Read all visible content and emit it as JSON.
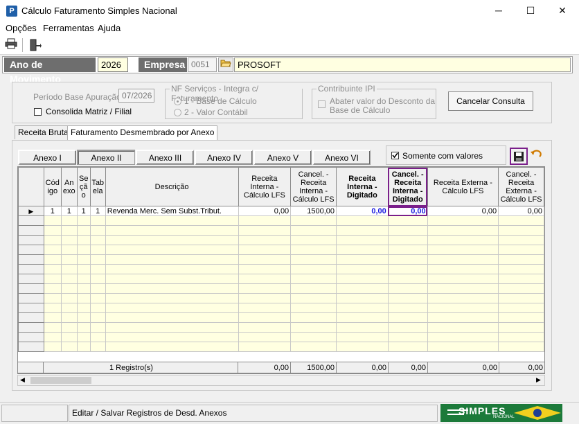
{
  "window": {
    "title": "Cálculo Faturamento Simples Nacional",
    "app_icon": "P",
    "minimize": "─",
    "maximize": "☐",
    "close": "✕"
  },
  "menu": {
    "items": [
      "Opções",
      "Ferramentas",
      "Ajuda"
    ]
  },
  "toolbar": {
    "print_icon": "printer-icon",
    "exit_icon": "exit-door-icon"
  },
  "header": {
    "ano_label": "Ano de Movimento",
    "ano_value": "2026",
    "empresa_label": "Empresa",
    "empresa_code": "0051",
    "empresa_name": "PROSOFT"
  },
  "filters": {
    "periodo_label": "Período Base Apuração:",
    "periodo_value": "07/2026",
    "consolida_label": "Consolida Matriz / Filial",
    "nf_group_title": "NF Serviços - Integra c/ Faturamento",
    "nf_option1": "1 - Base de Cálculo",
    "nf_option2": "2 - Valor Contábil",
    "ipi_group_title": "Contribuinte IPI",
    "ipi_check_line1": "Abater valor do Desconto da",
    "ipi_check_line2": "Base de Cálculo",
    "cancel_button": "Cancelar Consulta"
  },
  "tabs": [
    "Receita Bruta",
    "Faturamento Desmembrado por Anexo"
  ],
  "anexos": [
    "Anexo I",
    "Anexo II",
    "Anexo III",
    "Anexo IV",
    "Anexo V",
    "Anexo VI"
  ],
  "somente_label": "Somente com valores",
  "grid": {
    "headers": {
      "codigo": [
        "Cód",
        "igo"
      ],
      "anexo": [
        "An",
        "exo"
      ],
      "secao": [
        "Se",
        "çã",
        "o"
      ],
      "tabela": [
        "Tab",
        "ela"
      ],
      "descricao": "Descrição",
      "receita_interna_calc": [
        "Receita",
        "Interna -",
        "Cálculo LFS"
      ],
      "cancel_receita_interna_calc": [
        "Cancel. -",
        "Receita",
        "Interna -",
        "Cálculo LFS"
      ],
      "receita_interna_dig": [
        "Receita",
        "Interna -",
        "Digitado"
      ],
      "cancel_receita_interna_dig": [
        "Cancel. -",
        "Receita",
        "Interna -",
        "Digitado"
      ],
      "receita_externa_calc": [
        "Receita Externa -",
        "Cálculo LFS"
      ],
      "cancel_receita_externa_calc": [
        "Cancel. -",
        "Receita",
        "Externa -",
        "Cálculo LFS"
      ]
    },
    "row": {
      "codigo": "1",
      "anexo": "1",
      "secao": "1",
      "tabela": "1",
      "descricao": "Revenda Merc. Sem Subst.Tribut.",
      "ri_calc": "0,00",
      "cri_calc": "1500,00",
      "ri_dig": "0,00",
      "cri_dig": "0,00",
      "re_calc": "0,00",
      "cre_calc": "0,00"
    },
    "footer": {
      "registros": "1 Registro(s)",
      "ri_calc": "0,00",
      "cri_calc": "1500,00",
      "ri_dig": "0,00",
      "cri_dig": "0,00",
      "re_calc": "0,00",
      "cre_calc": "0,00"
    }
  },
  "statusbar": {
    "message": "Editar / Salvar Registros de Desd. Anexos",
    "logo_text": "SIMPLES",
    "logo_sub": "NACIONAL"
  }
}
